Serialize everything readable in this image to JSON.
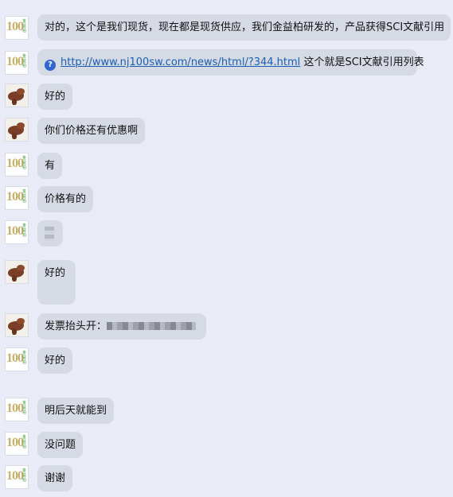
{
  "avatars": {
    "brand_number": "100",
    "brand_tag": "金益柏"
  },
  "messages": [
    {
      "sender": "brand",
      "text": "对的，这个是我们现货，现在都是现货供应，我们金益柏研发的，产品获得SCI文献引用"
    },
    {
      "sender": "brand",
      "icon": "info-icon",
      "link": "http://www.nj100sw.com/news/html/?344.html",
      "text": "这个就是SCI文献引用列表"
    },
    {
      "sender": "user",
      "text": "好的"
    },
    {
      "sender": "user",
      "text": "你们价格还有优惠啊"
    },
    {
      "sender": "brand",
      "text": "有"
    },
    {
      "sender": "brand",
      "text": "价格有的"
    },
    {
      "sender": "brand",
      "text": ""
    },
    {
      "sender": "user",
      "text": "好的"
    },
    {
      "sender": "user",
      "text": "发票抬头开："
    },
    {
      "sender": "brand",
      "text": "好的"
    },
    {
      "sender": "brand",
      "text": "明后天就能到"
    },
    {
      "sender": "brand",
      "text": "没问题"
    },
    {
      "sender": "brand",
      "text": "谢谢"
    }
  ]
}
